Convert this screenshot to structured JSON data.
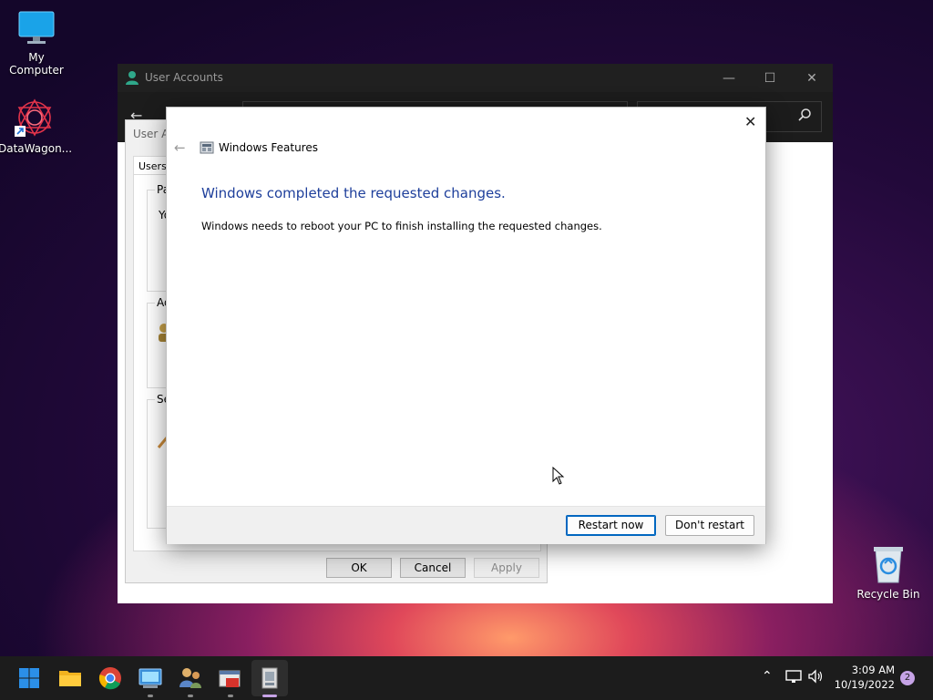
{
  "desktop": {
    "icons": [
      {
        "label": "My Computer"
      },
      {
        "label": "DataWagon..."
      },
      {
        "label": "Recycle Bin"
      }
    ]
  },
  "user_accounts_window": {
    "title": "User Accounts",
    "dialog": {
      "caption": "User Ac",
      "tab_users": "Users",
      "group1_label": "Pa",
      "group1_text": "Yo",
      "group2_label": "Ad",
      "group3_label": "Se",
      "ok": "OK",
      "cancel": "Cancel",
      "apply": "Apply"
    }
  },
  "windows_features": {
    "title": "Windows Features",
    "heading": "Windows completed the requested changes.",
    "message": "Windows needs to reboot your PC to finish installing the requested changes.",
    "restart_now": "Restart now",
    "dont_restart": "Don't restart"
  },
  "taskbar": {
    "time": "3:09 AM",
    "date": "10/19/2022",
    "notification_count": "2"
  },
  "colors": {
    "heading_blue": "#1e3f9b",
    "accent": "#0067c0"
  }
}
